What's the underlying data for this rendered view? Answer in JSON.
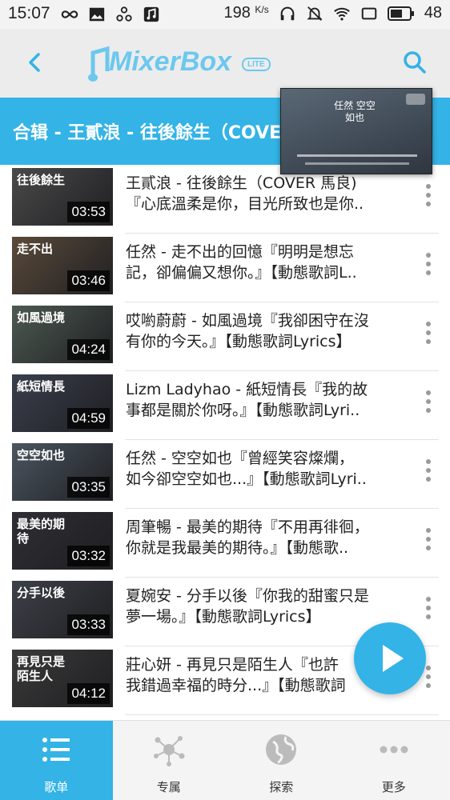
{
  "status_bar": {
    "time": "15:07",
    "net_speed": "198",
    "net_unit": "K/s",
    "battery": "48"
  },
  "header": {
    "logo_text": "MixerBox",
    "logo_badge": "LITE"
  },
  "playlist": {
    "title": "合辑 - 王貳浪 - 往後餘生（COVER 馬良）"
  },
  "mini_player": {
    "overlay_text": "任然 空空如也"
  },
  "songs": [
    {
      "line1": "王貳浪 - 往後餘生（COVER 馬良)",
      "line2": "『心底溫柔是你，目光所致也是你..",
      "duration": "03:53",
      "thumb_text": "往後餘生",
      "thumb_color": "#4a4a4a"
    },
    {
      "line1": "任然 - 走不出的回憶『明明是想忘",
      "line2": "記，卻偏偏又想你。』【動態歌詞L..",
      "duration": "03:46",
      "thumb_text": "走不出",
      "thumb_color": "#5a4a3a"
    },
    {
      "line1": "哎喲蔚蔚 - 如風過境『我卻困守在沒",
      "line2": "有你的今天。』【動態歌詞Lyrics】",
      "duration": "04:24",
      "thumb_text": "如風過境",
      "thumb_color": "#4d5a52"
    },
    {
      "line1": "Lizm Ladyhao - 紙短情長『我的故",
      "line2": "事都是關於你呀。』【動態歌詞Lyri..",
      "duration": "04:59",
      "thumb_text": "紙短情長",
      "thumb_color": "#3a3f4d"
    },
    {
      "line1": "任然 - 空空如也『曾經笑容燦爛，",
      "line2": "如今卻空空如也...』【動態歌詞Lyri..",
      "duration": "03:35",
      "thumb_text": "空空如也",
      "thumb_color": "#4b5560"
    },
    {
      "line1": "周筆暢 - 最美的期待『不用再徘徊，",
      "line2": "你就是我最美的期待。』【動態歌..",
      "duration": "03:32",
      "thumb_text": "最美的期待",
      "thumb_color": "#2e2e34"
    },
    {
      "line1": "夏婉安 - 分手以後『你我的甜蜜只是",
      "line2": "夢一場。』【動態歌詞Lyrics】",
      "duration": "03:33",
      "thumb_text": "分手以後",
      "thumb_color": "#3d4048"
    },
    {
      "line1": "莊心妍 - 再見只是陌生人『也許",
      "line2": "我錯過幸福的時分...』【動態歌詞",
      "duration": "04:12",
      "thumb_text": "再見只是陌生人",
      "thumb_color": "#3a3a3a"
    }
  ],
  "bottom_nav": [
    {
      "label": "歌单",
      "icon": "list-icon",
      "active": true
    },
    {
      "label": "专属",
      "icon": "network-icon",
      "active": false
    },
    {
      "label": "探索",
      "icon": "globe-icon",
      "active": false
    },
    {
      "label": "更多",
      "icon": "more-dots-icon",
      "active": false
    }
  ],
  "colors": {
    "accent": "#33b3e6",
    "header_bg": "#ececec"
  }
}
